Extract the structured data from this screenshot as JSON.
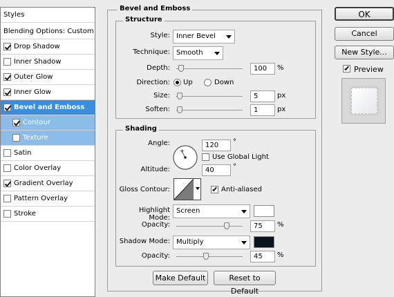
{
  "sidebar": {
    "header": "Styles",
    "blending": "Blending Options: Custom",
    "items": [
      {
        "label": "Drop Shadow",
        "checked": true
      },
      {
        "label": "Inner Shadow",
        "checked": false
      },
      {
        "label": "Outer Glow",
        "checked": true
      },
      {
        "label": "Inner Glow",
        "checked": true
      },
      {
        "label": "Bevel and Emboss",
        "checked": true
      },
      {
        "label": "Contour",
        "checked": true
      },
      {
        "label": "Texture",
        "checked": false
      },
      {
        "label": "Satin",
        "checked": false
      },
      {
        "label": "Color Overlay",
        "checked": false
      },
      {
        "label": "Gradient Overlay",
        "checked": true
      },
      {
        "label": "Pattern Overlay",
        "checked": false
      },
      {
        "label": "Stroke",
        "checked": false
      }
    ]
  },
  "bevel": {
    "title": "Bevel and Emboss",
    "structure": {
      "title": "Structure",
      "style_label": "Style:",
      "style_value": "Inner Bevel",
      "technique_label": "Technique:",
      "technique_value": "Smooth",
      "depth_label": "Depth:",
      "depth_value": "100",
      "depth_unit": "%",
      "depth_fraction": 0.1,
      "direction_label": "Direction:",
      "direction_up": "Up",
      "direction_down": "Down",
      "size_label": "Size:",
      "size_value": "5",
      "size_unit": "px",
      "size_fraction": 0.05,
      "soften_label": "Soften:",
      "soften_value": "1",
      "soften_unit": "px",
      "soften_fraction": 0.05
    },
    "shading": {
      "title": "Shading",
      "angle_label": "Angle:",
      "angle_value": "120",
      "angle_unit": "°",
      "global_light_label": "Use Global Light",
      "altitude_label": "Altitude:",
      "altitude_value": "40",
      "altitude_unit": "°",
      "gloss_label": "Gloss Contour:",
      "anti_aliased_label": "Anti-aliased",
      "highlight_mode_label": "Highlight Mode:",
      "highlight_mode_value": "Screen",
      "highlight_color": "#ffffff",
      "opacity_label": "Opacity:",
      "highlight_opacity_value": "75",
      "highlight_opacity_fraction": 0.75,
      "opacity_unit": "%",
      "shadow_mode_label": "Shadow Mode:",
      "shadow_mode_value": "Multiply",
      "shadow_color": "#0a141e",
      "shadow_opacity_value": "45",
      "shadow_opacity_fraction": 0.45
    },
    "make_default": "Make Default",
    "reset_default": "Reset to Default"
  },
  "actions": {
    "ok": "OK",
    "cancel": "Cancel",
    "new_style": "New Style...",
    "preview": "Preview"
  },
  "colors": {
    "active_row": "#3b8edf",
    "sub_row": "#8cbdea"
  }
}
